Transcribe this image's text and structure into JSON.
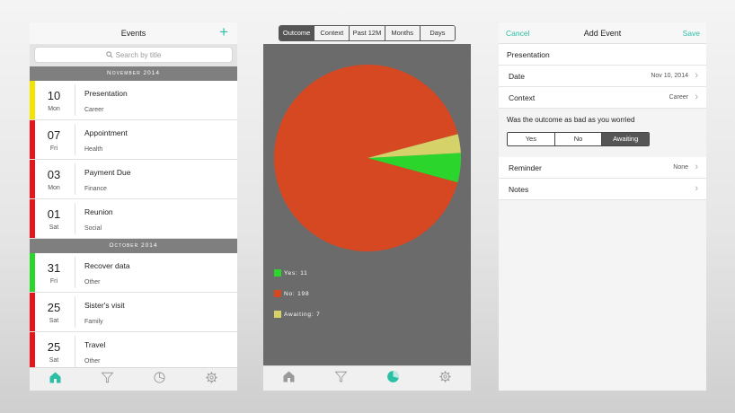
{
  "events_screen": {
    "title": "Events",
    "add_icon": "plus-icon",
    "search_placeholder": "Search by title",
    "sections": [
      {
        "header": "November 2014",
        "rows": [
          {
            "day": "10",
            "weekday": "Mon",
            "title": "Presentation",
            "category": "Career",
            "color": "#f2e300"
          },
          {
            "day": "07",
            "weekday": "Fri",
            "title": "Appointment",
            "category": "Health",
            "color": "#e8141a"
          },
          {
            "day": "03",
            "weekday": "Mon",
            "title": "Payment Due",
            "category": "Finance",
            "color": "#e8141a"
          },
          {
            "day": "01",
            "weekday": "Sat",
            "title": "Reunion",
            "category": "Social",
            "color": "#e8141a"
          }
        ]
      },
      {
        "header": "October 2014",
        "rows": [
          {
            "day": "31",
            "weekday": "Fri",
            "title": "Recover data",
            "category": "Other",
            "color": "#2ad62a"
          },
          {
            "day": "25",
            "weekday": "Sat",
            "title": "Sister's visit",
            "category": "Family",
            "color": "#e8141a"
          },
          {
            "day": "25",
            "weekday": "Sat",
            "title": "Travel",
            "category": "Other",
            "color": "#e8141a"
          }
        ]
      }
    ],
    "tabs": [
      "home-icon",
      "filter-icon",
      "chart-icon",
      "gear-icon"
    ],
    "active_tab": 0
  },
  "stats_screen": {
    "segments": [
      "Outcome",
      "Context",
      "Past 12M",
      "Months",
      "Days"
    ],
    "selected_segment": 0,
    "legend": [
      {
        "label": "Yes: 11",
        "color": "#2bd52b"
      },
      {
        "label": "No: 198",
        "color": "#d64822"
      },
      {
        "label": "Awaiting: 7",
        "color": "#d5d26a"
      }
    ],
    "tabs": [
      "home-icon",
      "filter-icon",
      "chart-icon",
      "gear-icon"
    ],
    "active_tab": 2
  },
  "chart_data": {
    "type": "pie",
    "categories": [
      "Yes",
      "No",
      "Awaiting"
    ],
    "values": [
      11,
      198,
      7
    ],
    "colors": [
      "#2bd52b",
      "#d64822",
      "#d5d26a"
    ]
  },
  "add_event_screen": {
    "cancel_label": "Cancel",
    "title": "Add Event",
    "save_label": "Save",
    "event_title": "Presentation",
    "date_label": "Date",
    "date_value": "Nov 10, 2014",
    "context_label": "Context",
    "context_value": "Career",
    "question": "Was the outcome as bad as you worried",
    "options": [
      "Yes",
      "No",
      "Awaiting"
    ],
    "selected_option": 2,
    "reminder_label": "Reminder",
    "reminder_value": "None",
    "notes_label": "Notes"
  },
  "accent_color": "#2bbfa5"
}
